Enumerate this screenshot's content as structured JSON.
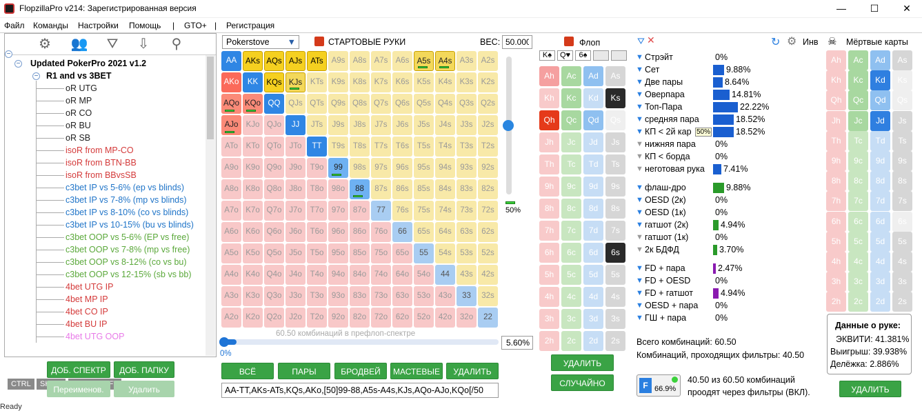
{
  "window": {
    "title": "FlopzillaPro v214: Зарегистрированная версия"
  },
  "menu": [
    "Файл",
    "Команды",
    "Настройки",
    "Помощь",
    "|",
    "GTO+",
    "|",
    "Регистрация"
  ],
  "tree": {
    "root": "Updated PokerPro 2021 v1.2",
    "folder": "R1 and vs 3BET",
    "items": [
      {
        "label": "oR UTG",
        "color": "#222"
      },
      {
        "label": "oR MP",
        "color": "#222"
      },
      {
        "label": "oR CO",
        "color": "#222"
      },
      {
        "label": "oR BU",
        "color": "#222"
      },
      {
        "label": "oR SB",
        "color": "#222"
      },
      {
        "label": "isoR from MP-CO",
        "color": "#d43a3a"
      },
      {
        "label": "isoR from BTN-BB",
        "color": "#d43a3a"
      },
      {
        "label": "isoR from BBvsSB",
        "color": "#d43a3a"
      },
      {
        "label": "c3bet IP vs 5-6% (ep vs blinds)",
        "color": "#1f74c8"
      },
      {
        "label": "c3bet IP vs 7-8% (mp vs blinds)",
        "color": "#1f74c8"
      },
      {
        "label": "c3bet IP vs 8-10% (co vs blinds)",
        "color": "#1f74c8"
      },
      {
        "label": "c3bet IP vs 10-15% (bu vs blinds)",
        "color": "#1f74c8"
      },
      {
        "label": "c3bet OOP vs 5-6% (EP vs free)",
        "color": "#5aa83a"
      },
      {
        "label": "c3bet OOP vs 7-8% (mp vs free)",
        "color": "#5aa83a"
      },
      {
        "label": "c3bet OOP vs 8-12% (co vs bu)",
        "color": "#5aa83a"
      },
      {
        "label": "c3bet OOP vs 12-15% (sb vs bb)",
        "color": "#5aa83a"
      },
      {
        "label": "4bet UTG IP",
        "color": "#d43a3a"
      },
      {
        "label": "4bet MP IP",
        "color": "#d43a3a"
      },
      {
        "label": "4bet CO IP",
        "color": "#d43a3a"
      },
      {
        "label": "4bet BU IP",
        "color": "#d43a3a"
      },
      {
        "label": "4bet UTG OOP",
        "color": "#e87ae8"
      }
    ],
    "keys": [
      "CTRL",
      "SHIFT",
      "CTRL+SHIFT"
    ],
    "buttons": {
      "add_range": "ДОБ. СПЕКТР",
      "add_folder": "ДОБ. ПАПКУ",
      "rename": "Переименов.",
      "delete": "Удалить"
    }
  },
  "range": {
    "source": "Pokerstove",
    "starting_hands": "СТАРТОВЫЕ РУКИ",
    "weight_label": "ВЕС:",
    "weight_value": "50.000",
    "slider_pct": "50%",
    "combos_text": "60.50 комбинаций в префлоп-спектре",
    "progress_left": "0%",
    "progress_right": "5.60%",
    "progress_fraction": 0.056,
    "buttons": [
      "ВСЁ",
      "ПАРЫ",
      "БРОДВЕЙ",
      "МАСТЕВЫЕ",
      "УДАЛИТЬ"
    ],
    "text": "AA-TT,AKs-ATs,KQs,AKo,[50]99-88,A5s-A4s,KJs,AQo-AJo,KQo[/50",
    "grid": [
      [
        "AA",
        "AKs",
        "AQs",
        "AJs",
        "ATs",
        "A9s",
        "A8s",
        "A7s",
        "A6s",
        "A5s",
        "A4s",
        "A3s",
        "A2s"
      ],
      [
        "AKo",
        "KK",
        "KQs",
        "KJs",
        "KTs",
        "K9s",
        "K8s",
        "K7s",
        "K6s",
        "K5s",
        "K4s",
        "K3s",
        "K2s"
      ],
      [
        "AQo",
        "KQo",
        "QQ",
        "QJs",
        "QTs",
        "Q9s",
        "Q8s",
        "Q7s",
        "Q6s",
        "Q5s",
        "Q4s",
        "Q3s",
        "Q2s"
      ],
      [
        "AJo",
        "KJo",
        "QJo",
        "JJ",
        "JTs",
        "J9s",
        "J8s",
        "J7s",
        "J6s",
        "J5s",
        "J4s",
        "J3s",
        "J2s"
      ],
      [
        "ATo",
        "KTo",
        "QTo",
        "JTo",
        "TT",
        "T9s",
        "T8s",
        "T7s",
        "T6s",
        "T5s",
        "T4s",
        "T3s",
        "T2s"
      ],
      [
        "A9o",
        "K9o",
        "Q9o",
        "J9o",
        "T9o",
        "99",
        "98s",
        "97s",
        "96s",
        "95s",
        "94s",
        "93s",
        "92s"
      ],
      [
        "A8o",
        "K8o",
        "Q8o",
        "J8o",
        "T8o",
        "98o",
        "88",
        "87s",
        "86s",
        "85s",
        "84s",
        "83s",
        "82s"
      ],
      [
        "A7o",
        "K7o",
        "Q7o",
        "J7o",
        "T7o",
        "97o",
        "87o",
        "77",
        "76s",
        "75s",
        "74s",
        "73s",
        "72s"
      ],
      [
        "A6o",
        "K6o",
        "Q6o",
        "J6o",
        "T6o",
        "96o",
        "86o",
        "76o",
        "66",
        "65s",
        "64s",
        "63s",
        "62s"
      ],
      [
        "A5o",
        "K5o",
        "Q5o",
        "J5o",
        "T5o",
        "95o",
        "85o",
        "75o",
        "65o",
        "55",
        "54s",
        "53s",
        "52s"
      ],
      [
        "A4o",
        "K4o",
        "Q4o",
        "J4o",
        "T4o",
        "94o",
        "84o",
        "74o",
        "64o",
        "54o",
        "44",
        "43s",
        "42s"
      ],
      [
        "A3o",
        "K3o",
        "Q3o",
        "J3o",
        "T3o",
        "93o",
        "83o",
        "73o",
        "63o",
        "53o",
        "43o",
        "33",
        "32s"
      ],
      [
        "A2o",
        "K2o",
        "Q2o",
        "J2o",
        "T2o",
        "92o",
        "82o",
        "72o",
        "62o",
        "52o",
        "42o",
        "32o",
        "22"
      ]
    ],
    "full": [
      "AA",
      "AKs",
      "AQs",
      "AJs",
      "ATs",
      "AKo",
      "KK",
      "KQs",
      "QQ",
      "JJ",
      "TT"
    ],
    "half": [
      "A5s",
      "A4s",
      "KJs",
      "AQo",
      "AJo",
      "KQo",
      "99",
      "88"
    ]
  },
  "flop": {
    "title": "Флоп",
    "slots": [
      "K♠",
      "Q♥",
      "6♠",
      "",
      ""
    ],
    "delete": "УДАЛИТЬ",
    "random": "СЛУЧАЙНО"
  },
  "dead": {
    "title": "Мёртвые карты",
    "inv": "Инв"
  },
  "filters": {
    "groups": [
      [
        {
          "label": "Стрэйт",
          "value": "0%",
          "pct": 0,
          "color": "#2a7fe0",
          "active": true
        },
        {
          "label": "Сет",
          "value": "9.88%",
          "pct": 9.88,
          "color": "#1a5fd0",
          "active": true
        },
        {
          "label": "Две пары",
          "value": "8.64%",
          "pct": 8.64,
          "color": "#1a5fd0",
          "active": true
        },
        {
          "label": "Оверпара",
          "value": "14.81%",
          "pct": 14.81,
          "color": "#1a5fd0",
          "active": true
        },
        {
          "label": "Топ-Пара",
          "value": "22.22%",
          "pct": 22.22,
          "color": "#1a5fd0",
          "active": true
        },
        {
          "label": "средняя пара",
          "value": "18.52%",
          "pct": 18.52,
          "color": "#1a5fd0",
          "active": true
        },
        {
          "label": "КП < 2й кар",
          "value": "18.52%",
          "pct": 18.52,
          "color": "#1a5fd0",
          "active": true,
          "tag": "50%"
        },
        {
          "label": "нижняя пара",
          "value": "0%",
          "pct": 0,
          "color": "#1a5fd0",
          "active": false
        },
        {
          "label": "КП < борда",
          "value": "0%",
          "pct": 0,
          "color": "#1a5fd0",
          "active": false
        },
        {
          "label": "неготовая рука",
          "value": "7.41%",
          "pct": 7.41,
          "color": "#1a5fd0",
          "active": false
        }
      ],
      [
        {
          "label": "флаш-дро",
          "value": "9.88%",
          "pct": 9.88,
          "color": "#2a9a2a",
          "active": true
        },
        {
          "label": "OESD (2к)",
          "value": "0%",
          "pct": 0,
          "color": "#2a9a2a",
          "active": true
        },
        {
          "label": "OESD (1к)",
          "value": "0%",
          "pct": 0,
          "color": "#2a9a2a",
          "active": true
        },
        {
          "label": "гатшот (2к)",
          "value": "4.94%",
          "pct": 4.94,
          "color": "#2a9a2a",
          "active": true
        },
        {
          "label": "гатшот (1к)",
          "value": "0%",
          "pct": 0,
          "color": "#2a9a2a",
          "active": false
        },
        {
          "label": "2к БДФД",
          "value": "3.70%",
          "pct": 3.7,
          "color": "#2a9a2a",
          "active": false
        }
      ],
      [
        {
          "label": "FD + пара",
          "value": "2.47%",
          "pct": 2.47,
          "color": "#8a1ab0",
          "active": true
        },
        {
          "label": "FD + OESD",
          "value": "0%",
          "pct": 0,
          "color": "#8a1ab0",
          "active": true
        },
        {
          "label": "FD + гатшот",
          "value": "4.94%",
          "pct": 4.94,
          "color": "#8a1ab0",
          "active": true
        },
        {
          "label": "OESD + пара",
          "value": "0%",
          "pct": 0,
          "color": "#8a1ab0",
          "active": true
        },
        {
          "label": "ГШ + пара",
          "value": "0%",
          "pct": 0,
          "color": "#8a1ab0",
          "active": true
        }
      ]
    ],
    "total": "Всего комбинаций: 60.50",
    "passing": "Комбинаций, проходящих фильтры: 40.50",
    "badge_pct": "66.9%",
    "summary1": "40.50 из 60.50 комбинаций",
    "summary2": "проодят через фильтры (ВКЛ)."
  },
  "hand": {
    "title": "Данные о руке:",
    "equity": "ЭКВИТИ: 41.381%",
    "win": "Выигрыш: 39.938%",
    "tie": "Делёжка: 2.886%",
    "delete": "УДАЛИТЬ"
  },
  "status": "Ready"
}
